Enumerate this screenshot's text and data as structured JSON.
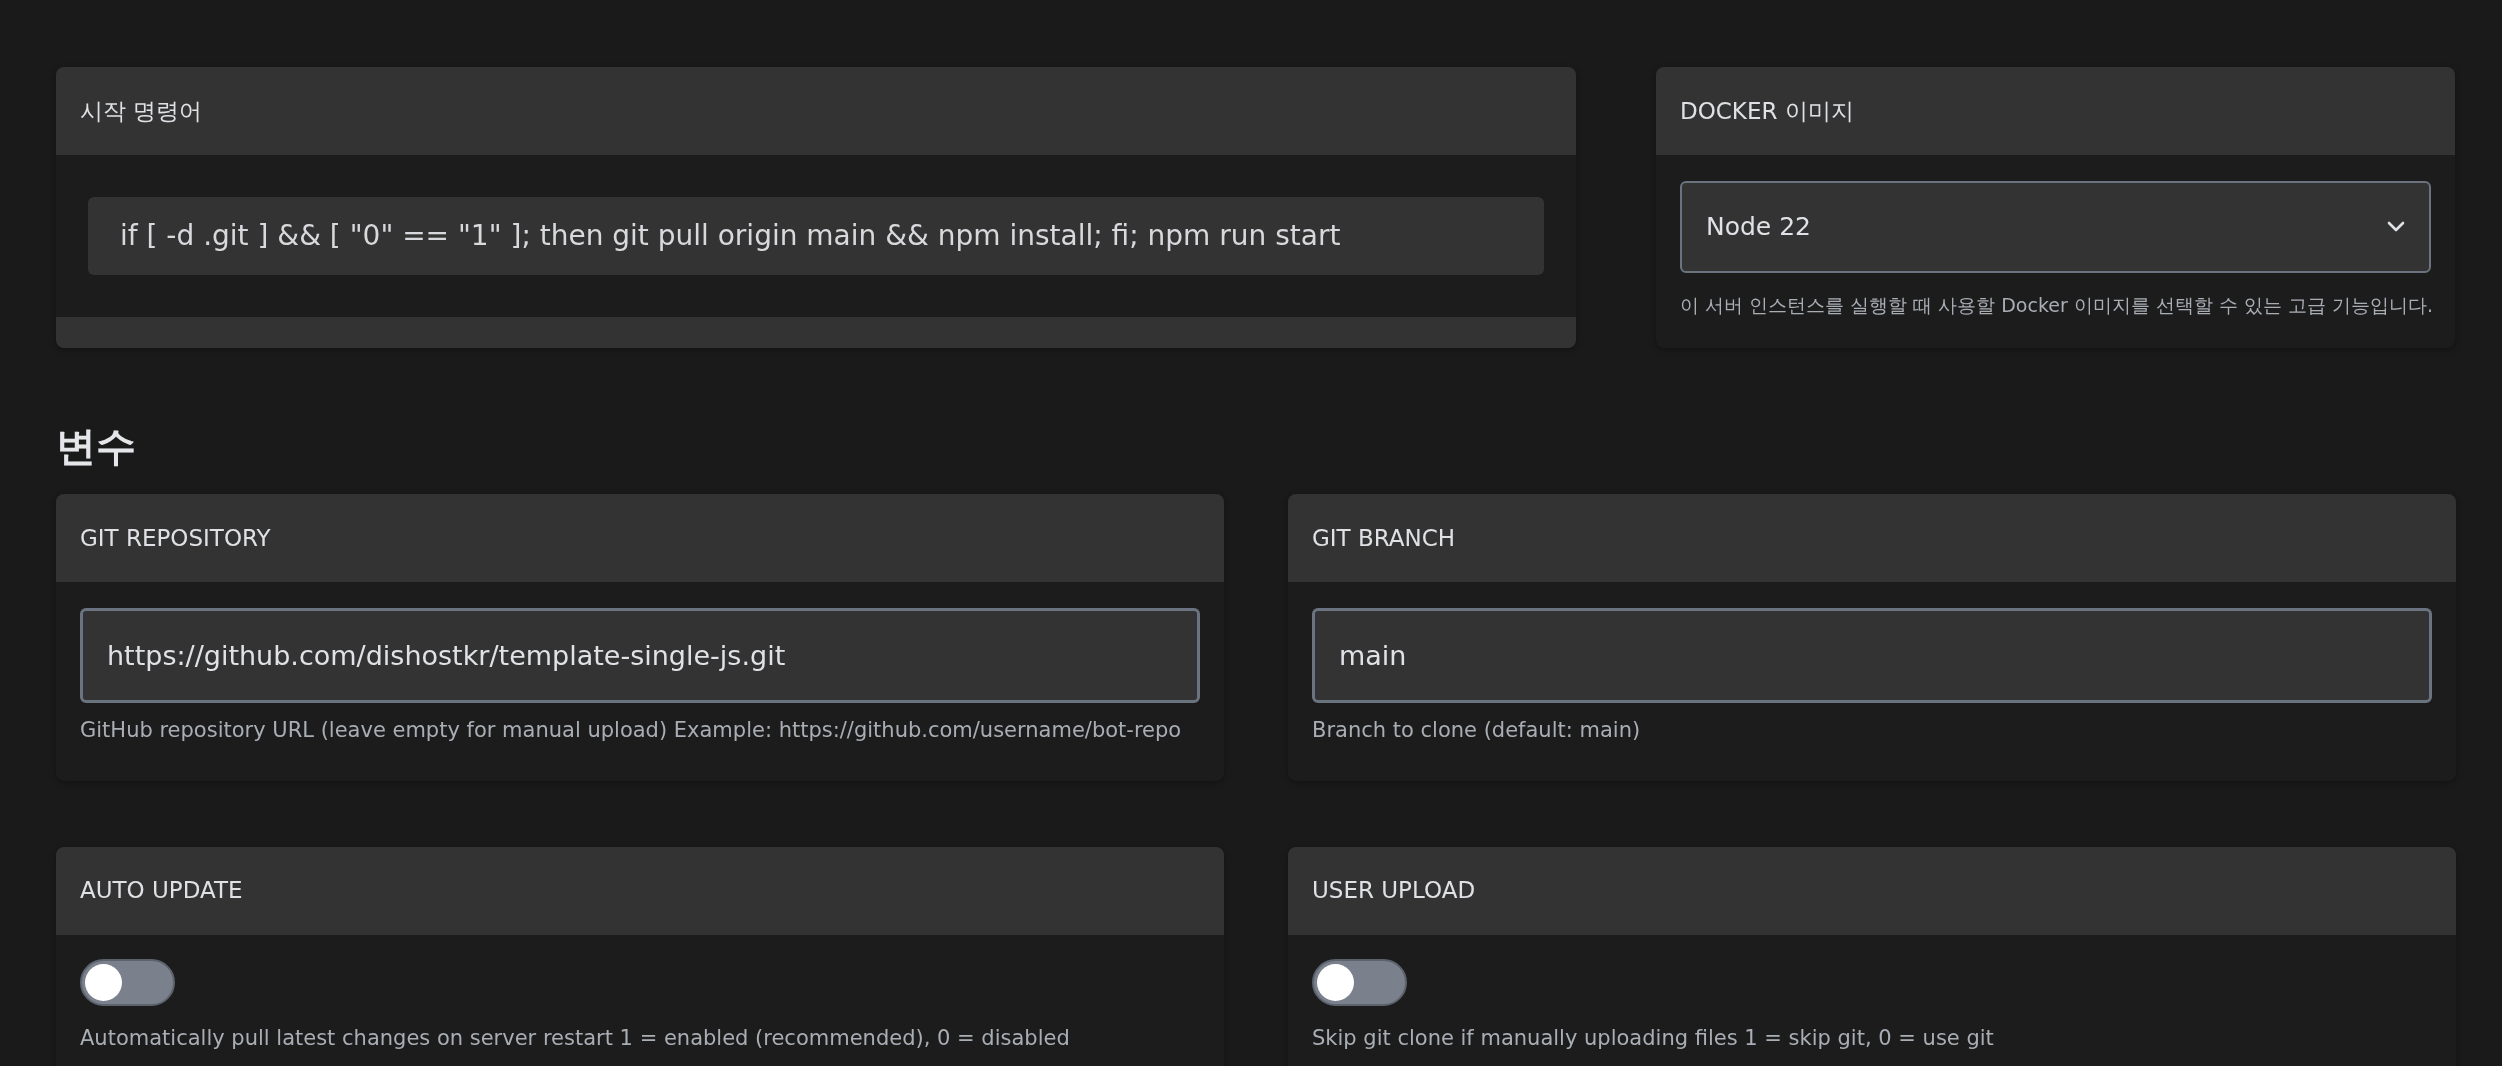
{
  "startup": {
    "title": "시작 명령어",
    "command": "if [ -d .git ] && [ \"0\" == \"1\" ]; then git pull origin main && npm install; fi; npm run start"
  },
  "docker": {
    "title": "DOCKER 이미지",
    "selected_image": "Node 22",
    "help": "이 서버 인스턴스를 실행할 때 사용할 Docker 이미지를 선택할 수 있는 고급 기능입니다."
  },
  "variables_heading": "변수",
  "variables": [
    {
      "kind": "text",
      "title": "GIT REPOSITORY",
      "value": "https://github.com/dishostkr/template-single-js.git",
      "help": "GitHub repository URL (leave empty for manual upload) Example: https://github.com/username/bot-repo"
    },
    {
      "kind": "text",
      "title": "GIT BRANCH",
      "value": "main",
      "help": "Branch to clone (default: main)"
    },
    {
      "kind": "toggle",
      "title": "AUTO UPDATE",
      "on": false,
      "help": "Automatically pull latest changes on server restart 1 = enabled (recommended), 0 = disabled"
    },
    {
      "kind": "toggle",
      "title": "USER UPLOAD",
      "on": false,
      "help": "Skip git clone if manually uploading files 1 = skip git, 0 = use git"
    }
  ]
}
